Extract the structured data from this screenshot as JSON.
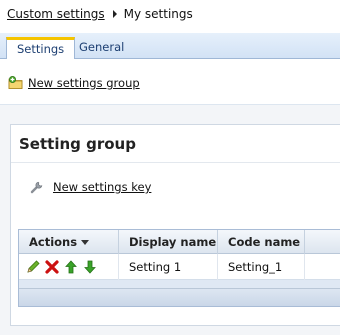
{
  "breadcrumb": {
    "parent": "Custom settings",
    "current": "My settings"
  },
  "tabs": [
    {
      "label": "Settings"
    },
    {
      "label": "General"
    }
  ],
  "toolbar": {
    "new_group_label": "New settings group",
    "icon": "add-folder-icon"
  },
  "panel": {
    "title": "Setting group",
    "new_key_label": "New settings key",
    "key_icon": "wrench-icon"
  },
  "grid": {
    "columns": {
      "actions": "Actions",
      "display": "Display name",
      "code": "Code name"
    },
    "rows": [
      {
        "display": "Setting 1",
        "code": "Setting_1",
        "actions": [
          "edit-icon",
          "delete-icon",
          "move-up-icon",
          "move-down-icon"
        ]
      }
    ]
  },
  "colors": {
    "tab_accent": "#f5c400",
    "header_bg": "#d2e2f5",
    "edit": "#5a9e1e",
    "delete": "#cc1111",
    "arrows": "#3aa32a"
  }
}
